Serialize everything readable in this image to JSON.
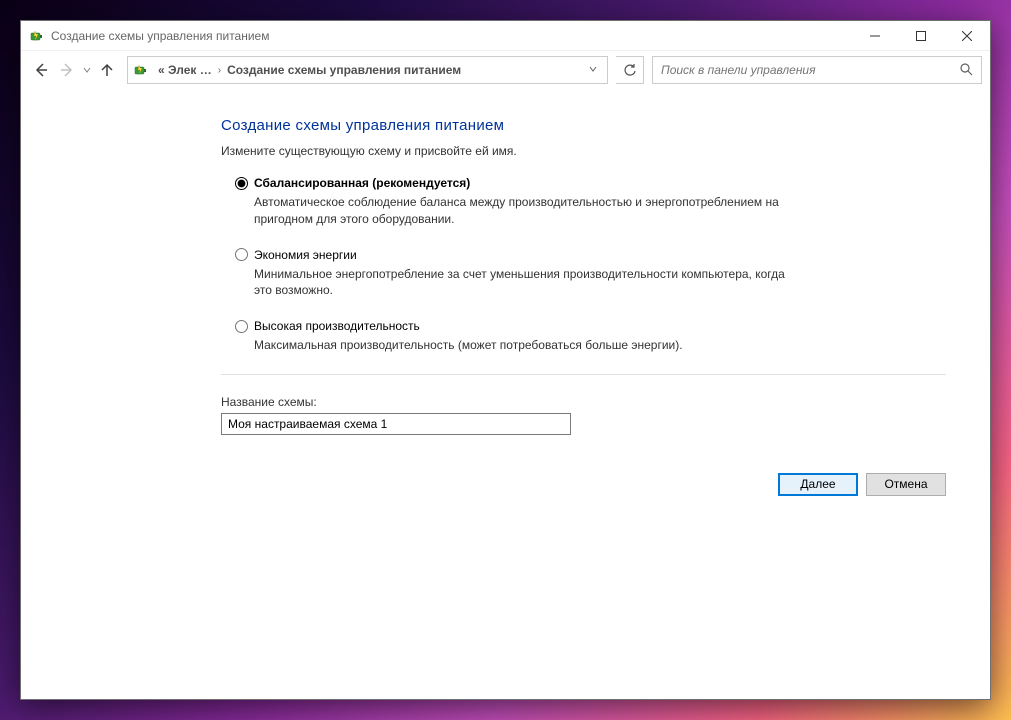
{
  "window": {
    "title": "Создание схемы управления питанием"
  },
  "breadcrumb": {
    "first": "« Элек …",
    "last": "Создание схемы управления питанием"
  },
  "search": {
    "placeholder": "Поиск в панели управления"
  },
  "page": {
    "title": "Создание схемы управления питанием",
    "subtitle": "Измените существующую схему и присвойте ей имя."
  },
  "options": {
    "balanced": {
      "label": "Сбалансированная (рекомендуется)",
      "desc": "Автоматическое соблюдение баланса между производительностью и энергопотреблением на пригодном для этого оборудовании."
    },
    "saver": {
      "label": "Экономия энергии",
      "desc": "Минимальное энергопотребление за счет уменьшения производительности компьютера, когда это возможно."
    },
    "perf": {
      "label": "Высокая производительность",
      "desc": "Максимальная производительность (может потребоваться больше энергии)."
    }
  },
  "scheme_name": {
    "label": "Название схемы:",
    "value": "Моя настраиваемая схема 1"
  },
  "buttons": {
    "next": "Далее",
    "cancel": "Отмена"
  }
}
